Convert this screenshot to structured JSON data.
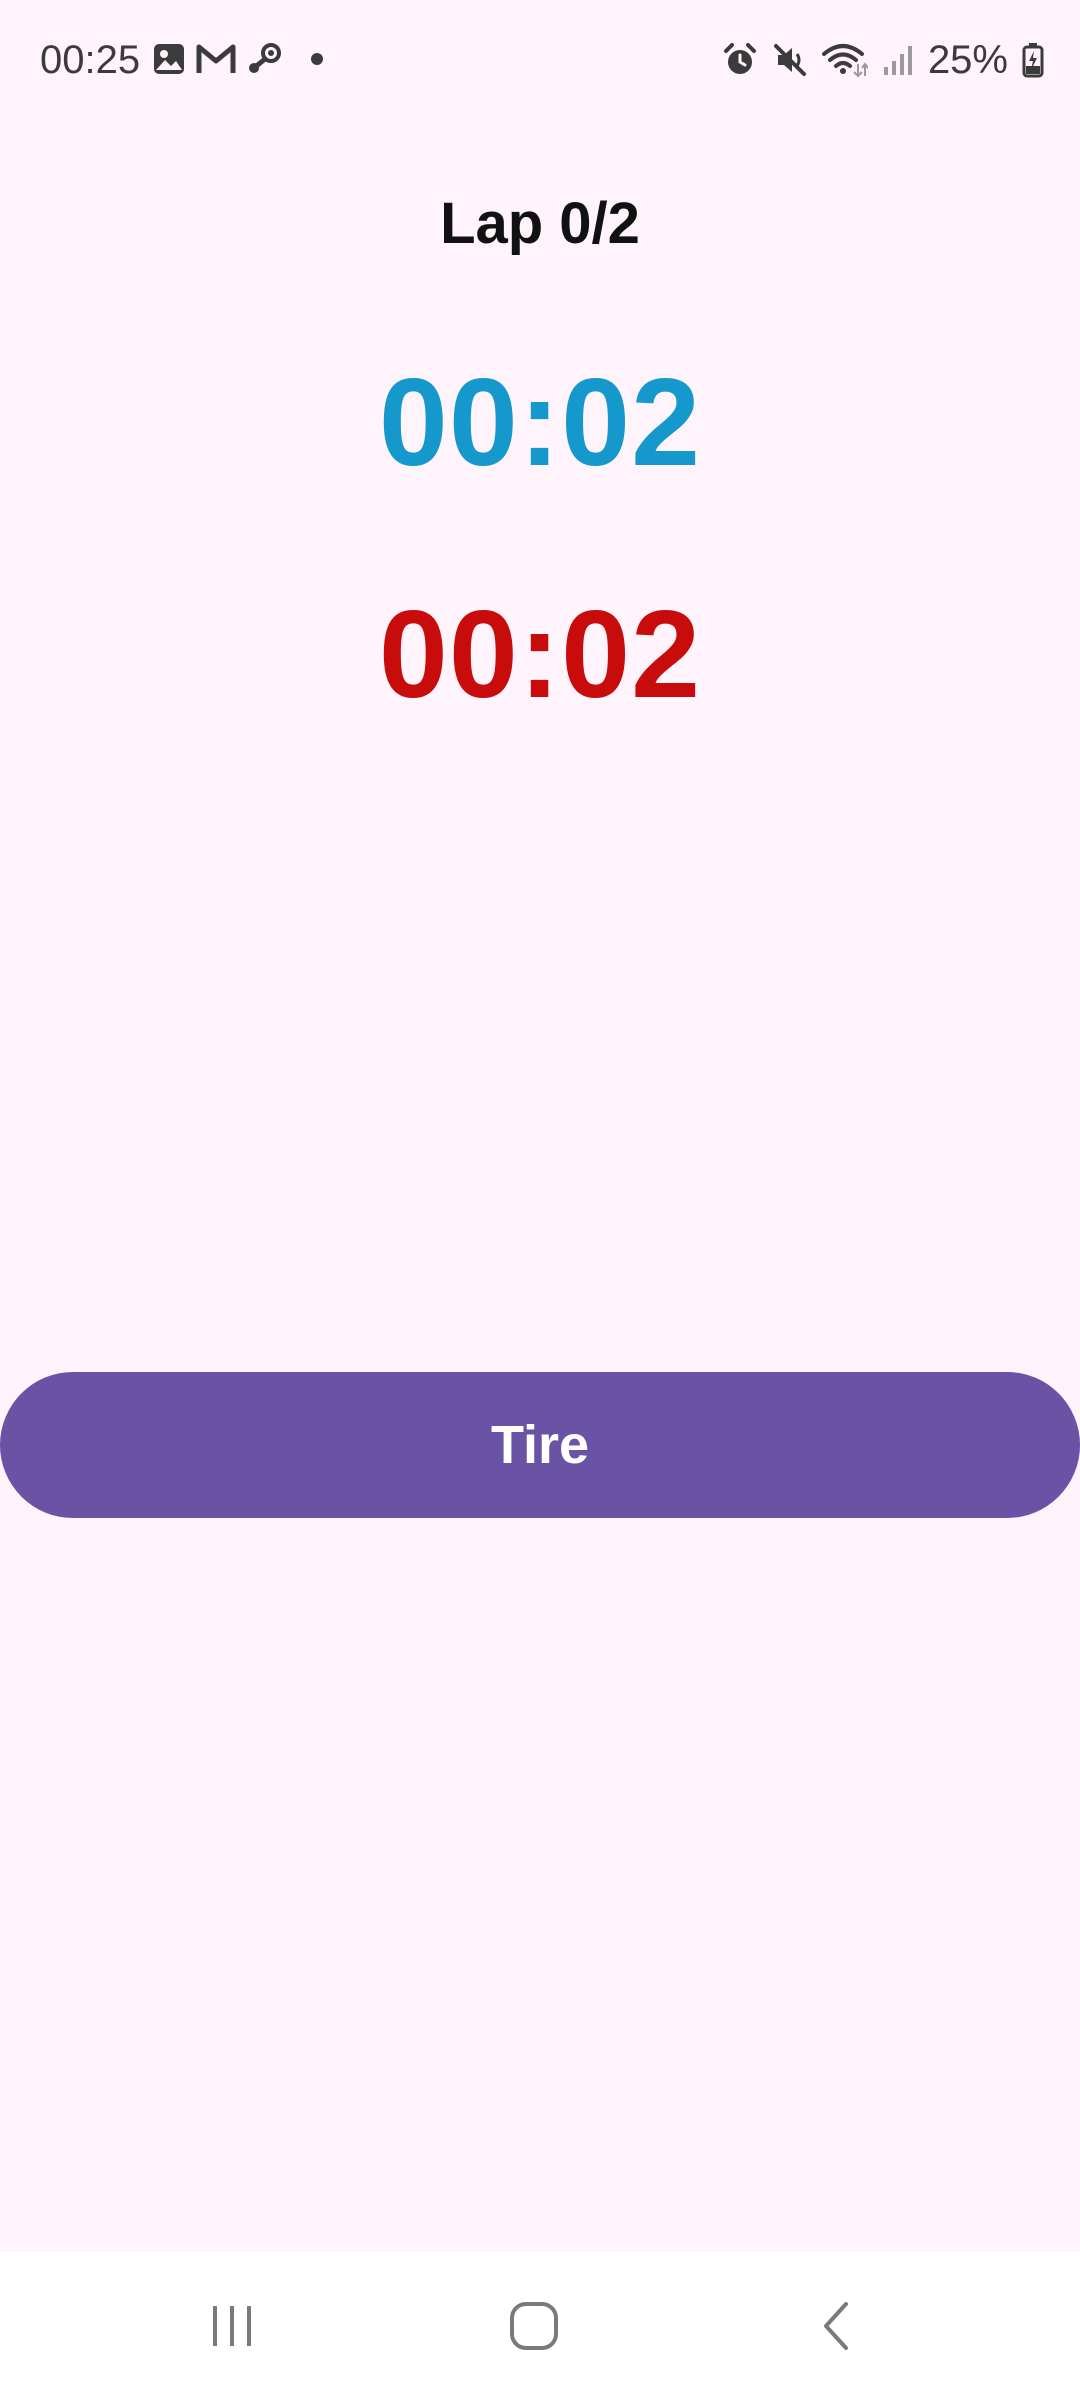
{
  "status_bar": {
    "time": "00:25",
    "battery_percent": "25%",
    "left_icons": [
      "gallery-icon",
      "gmail-icon",
      "steam-icon",
      "notification-dot-icon"
    ],
    "right_icons": [
      "alarm-icon",
      "mute-icon",
      "wifi-icon",
      "signal-icon",
      "battery-charging-icon"
    ]
  },
  "main": {
    "lap_label": "Lap 0/2",
    "timer_primary": "00:02",
    "timer_secondary": "00:02",
    "button_label": "Tire"
  },
  "colors": {
    "background": "#fff3fc",
    "timer_primary": "#1599cc",
    "timer_secondary": "#c80b0b",
    "button": "#6a52a5"
  },
  "nav_bar": {
    "buttons": [
      "recent-apps-icon",
      "home-icon",
      "back-icon"
    ]
  }
}
